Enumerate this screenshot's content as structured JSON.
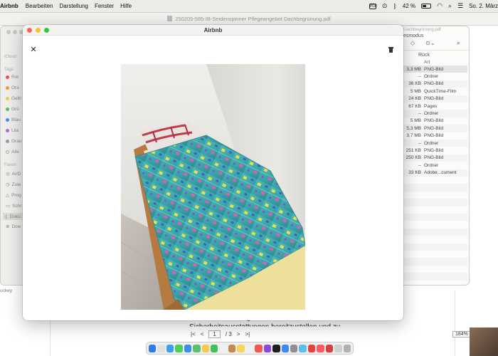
{
  "menubar": {
    "app_name": "Airbnb",
    "items": [
      "Bearbeiten",
      "Darstellung",
      "Fenster",
      "Hilfe"
    ],
    "battery": "42 %",
    "datetime": "So. 2. März"
  },
  "pdf_viewer": {
    "title": "250205-585-IB-Seidenspinner Pflegeangebot Dachbegrünung.pdf",
    "text_line1": "Sicherheitsausstattungen bereitzustellen und zu",
    "text_line2": "Sicherheitsausstattungen bereitzustellen und zu",
    "page_current": "1",
    "page_total": "/ 3",
    "zoom": "184%"
  },
  "finder": {
    "sidebar": {
      "icloud_header": "iCloud",
      "tags_header": "Tags",
      "tags": [
        {
          "label": "Rot",
          "color": "#f04c4c"
        },
        {
          "label": "Ora",
          "color": "#f59a2f"
        },
        {
          "label": "Gelb",
          "color": "#f2cf35"
        },
        {
          "label": "Grü",
          "color": "#57c25a"
        },
        {
          "label": "Blau",
          "color": "#3b8ff0"
        },
        {
          "label": "Lila",
          "color": "#b06ae0"
        },
        {
          "label": "Grau",
          "color": "#9a9a9a"
        },
        {
          "label": "Alle",
          "color": ""
        }
      ],
      "favorites_header": "Favori",
      "favorites": [
        "AirD",
        "Zule",
        "Prog",
        "Schr",
        "Doku",
        "Dow"
      ]
    },
    "other_window_title": "Dachbegrünung.pdf",
    "view_mode": "esmodus",
    "back_label": "Rück",
    "kind_header": "Art",
    "rows": [
      {
        "size": "3,3 MB",
        "kind": "PNG-Bild"
      },
      {
        "size": "--",
        "kind": "Ordner"
      },
      {
        "size": "36 KB",
        "kind": "PNG-Bild"
      },
      {
        "size": "5 MB",
        "kind": "QuickTime-Film"
      },
      {
        "size": "24 KB",
        "kind": "PNG-Bild"
      },
      {
        "size": "67 KB",
        "kind": "Pages"
      },
      {
        "size": "--",
        "kind": "Ordner"
      },
      {
        "size": "5 MB",
        "kind": "PNG-Bild"
      },
      {
        "size": "5,3 MB",
        "kind": "PNG-Bild"
      },
      {
        "size": "3,7 MB",
        "kind": "PNG-Bild"
      },
      {
        "size": "--",
        "kind": "Ordner"
      },
      {
        "size": "251 KB",
        "kind": "PNG-Bild"
      },
      {
        "size": "250 KB",
        "kind": "PNG-Bild"
      },
      {
        "size": "--",
        "kind": "Ordner"
      },
      {
        "size": "33 KB",
        "kind": "Adobe...cument"
      }
    ],
    "left_text": "ockey"
  },
  "airbnb_window": {
    "title": "Airbnb",
    "close_icon": "close-icon",
    "trash_icon": "trash-icon",
    "photo_alt": "Photo of a single bed with blue patterned duvet"
  },
  "colors": {
    "traffic_red": "#ff5f57",
    "traffic_yellow": "#febc2e",
    "traffic_green": "#28c840"
  }
}
